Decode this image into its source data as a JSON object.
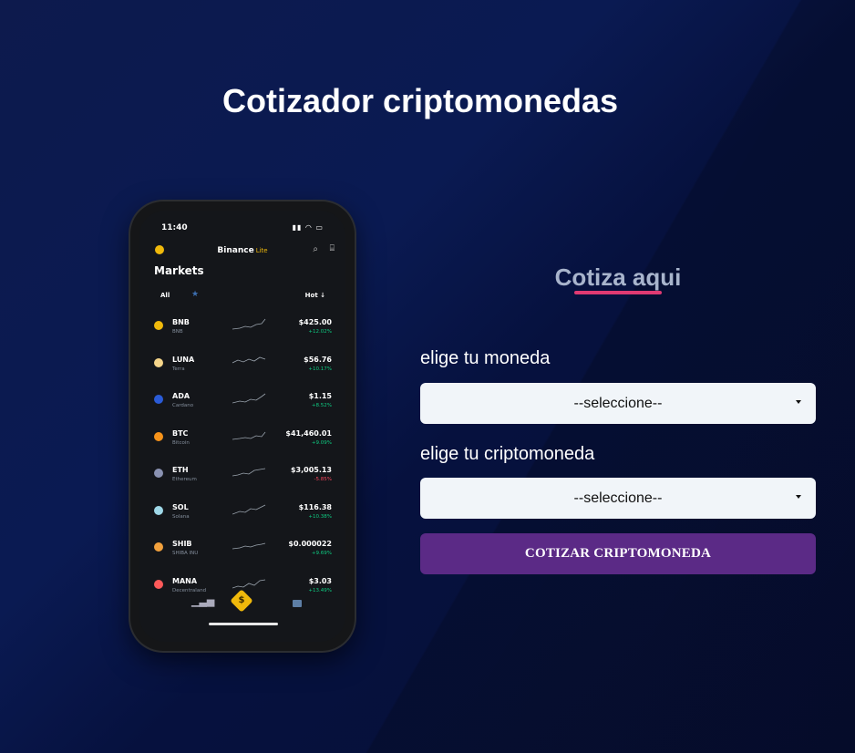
{
  "page": {
    "title": "Cotizador criptomonedas"
  },
  "phone": {
    "time": "11:40",
    "status_icons": "▮▮ ◠ ▭",
    "app_name": "Binance",
    "app_suffix": "Lite",
    "search_icon": "⌕",
    "scan_icon": "⌸",
    "markets_title": "Markets",
    "tab_all": "All",
    "tab_star": "★",
    "tab_hot": "Hot ↓",
    "coins": [
      {
        "symbol": "BNB",
        "name": "BNB",
        "price": "$425.00",
        "change": "+12.02%",
        "color": "#f0b90b"
      },
      {
        "symbol": "LUNA",
        "name": "Terra",
        "price": "$56.76",
        "change": "+10.17%",
        "color": "#f5d58a"
      },
      {
        "symbol": "ADA",
        "name": "Cardano",
        "price": "$1.15",
        "change": "+8.52%",
        "color": "#2a5bd7"
      },
      {
        "symbol": "BTC",
        "name": "Bitcoin",
        "price": "$41,460.01",
        "change": "+9.09%",
        "color": "#f7931a"
      },
      {
        "symbol": "ETH",
        "name": "Ethereum",
        "price": "$3,005.13",
        "change": "-5.85%",
        "color": "#8a92b2"
      },
      {
        "symbol": "SOL",
        "name": "Solana",
        "price": "$116.38",
        "change": "+10.38%",
        "color": "#9fd8e8"
      },
      {
        "symbol": "SHIB",
        "name": "SHIBA INU",
        "price": "$0.000022",
        "change": "+9.69%",
        "color": "#f2a13d"
      },
      {
        "symbol": "MANA",
        "name": "Decentraland",
        "price": "$3.03",
        "change": "+13.49%",
        "color": "#ff5a5a"
      }
    ],
    "nav_chart_icon": "▁▃▅",
    "nav_center_icon": "$"
  },
  "form": {
    "section_title": "Cotiza aqui",
    "currency_label": "elige tu moneda",
    "currency_value": "--seleccione--",
    "crypto_label": "elige tu criptomoneda",
    "crypto_value": "--seleccione--",
    "submit_label": "COTIZAR CRIPTOMONEDA"
  },
  "colors": {
    "accent_underline": "#e03a72",
    "button": "#5b2a86",
    "background": "#0a1a52"
  }
}
